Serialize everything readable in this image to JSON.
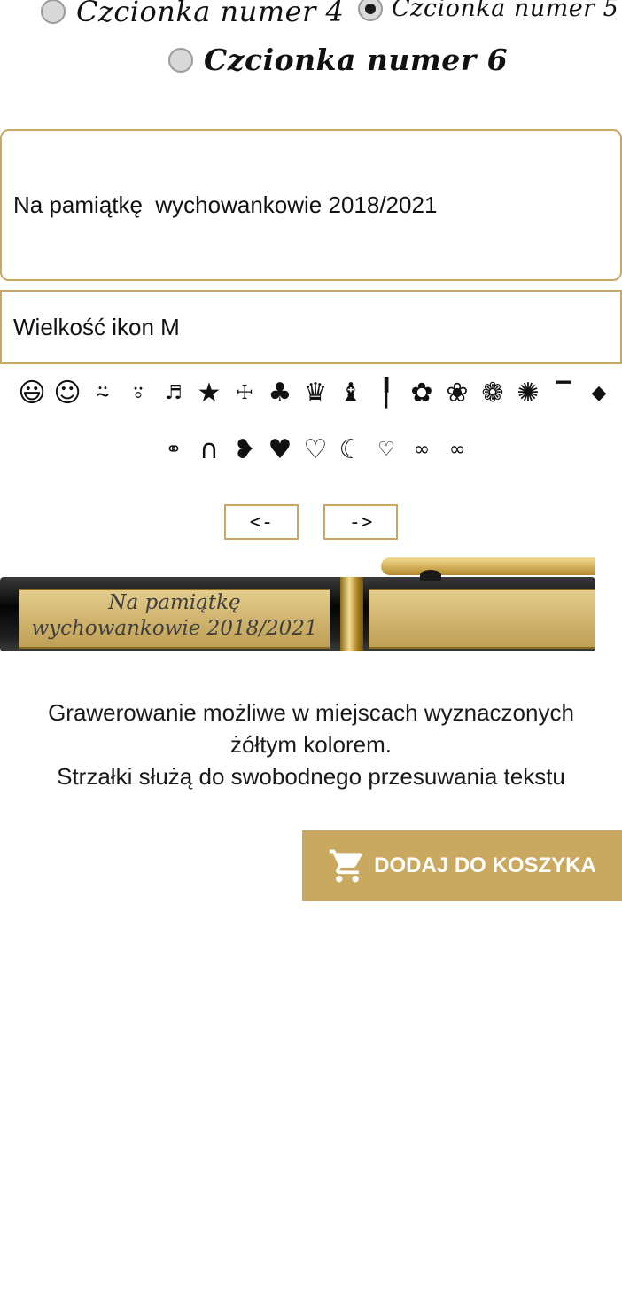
{
  "fonts": {
    "options": [
      {
        "label": "Czcionka numer 4",
        "selected": false
      },
      {
        "label": "Czcionka numer 5",
        "selected": true
      },
      {
        "label": "Czcionka numer 6",
        "selected": false
      }
    ]
  },
  "engraving": {
    "text": "Na pamiątkę  wychowankowie 2018/2021",
    "icon_size_select": "Wielkość ikon M"
  },
  "icons": {
    "row1": [
      "grinning-face-icon",
      "smiling-face-icon",
      "wide-smile-icon",
      "big-grin-icon",
      "music-notes-icon",
      "star-icon",
      "ihs-cross-icon",
      "four-leaf-clover-icon",
      "crown-icon",
      "cat-icon",
      "necktie-icon",
      "rose-icon",
      "rose-bud-icon",
      "paw-print-icon",
      "award-rosette-icon",
      "graduation-cap-side-icon",
      "graduation-cap-icon"
    ],
    "row2": [
      "wedding-rings-icon",
      "horseshoe-icon",
      "broken-heart-icon",
      "heart-filled-icon",
      "heart-outline-icon",
      "crescent-moon-icon",
      "double-heart-outline-icon",
      "infinity-icon",
      "infinity-outline-icon"
    ]
  },
  "arrows": {
    "left": "<-",
    "right": "->"
  },
  "preview": {
    "line1": "Na pamiątkę",
    "line2": "wychowankowie 2018/2021"
  },
  "info": {
    "line1": "Grawerowanie możliwe w miejscach wyznaczonych",
    "line2": "żółtym kolorem.",
    "line3": "Strzałki służą do swobodnego przesuwania tekstu"
  },
  "cart": {
    "label": "DODAJ DO KOSZYKA"
  },
  "colors": {
    "accent": "#c9a95f",
    "background": "#ffffff",
    "text": "#1a1a1a"
  }
}
